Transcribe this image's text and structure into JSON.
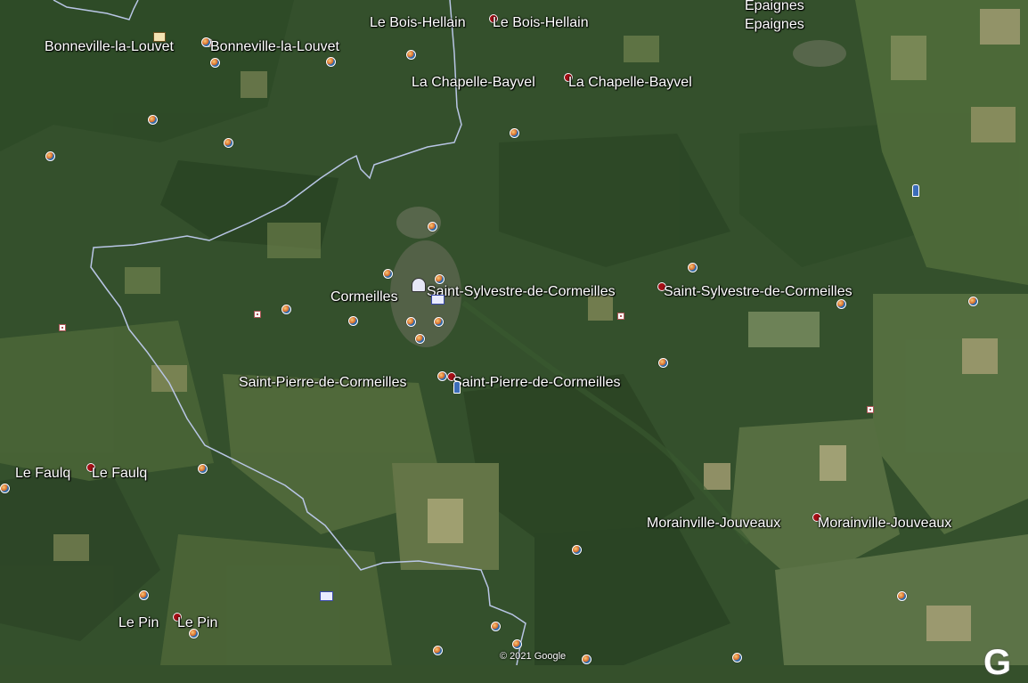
{
  "map": {
    "type": "satellite",
    "copyright": "© 2021 Google",
    "logo_letter": "G",
    "places": [
      {
        "id": "bonneville-la-louvet",
        "label": "Bonneville-la-Louvet",
        "label_repeat": "Bonneville-la-Louvet"
      },
      {
        "id": "le-bois-hellain",
        "label": "Le Bois-Hellain",
        "label_repeat": "Le Bois-Hellain"
      },
      {
        "id": "epaignes",
        "label": "Epaignes",
        "label_repeat": "Epaignes"
      },
      {
        "id": "la-chapelle-bayvel",
        "label": "La Chapelle-Bayvel",
        "label_repeat": "La Chapelle-Bayvel"
      },
      {
        "id": "cormeilles",
        "label": "Cormeilles"
      },
      {
        "id": "saint-sylvestre-de-cormeilles",
        "label": "Saint-Sylvestre-de-Cormeilles",
        "label_repeat": "Saint-Sylvestre-de-Cormeilles"
      },
      {
        "id": "saint-pierre-de-cormeilles",
        "label": "Saint-Pierre-de-Cormeilles",
        "label_repeat": "Saint-Pierre-de-Cormeilles"
      },
      {
        "id": "le-faulq",
        "label": "Le Faulq",
        "label_repeat": "Le Faulq"
      },
      {
        "id": "morainville-jouveaux",
        "label": "Morainville-Jouveaux",
        "label_repeat": "Morainville-Jouveaux"
      },
      {
        "id": "le-pin",
        "label": "Le Pin",
        "label_repeat": "Le Pin"
      }
    ],
    "colors": {
      "boundary": "#b9c6e6",
      "label_text": "#ffffff",
      "pin": "#a40f16"
    }
  }
}
